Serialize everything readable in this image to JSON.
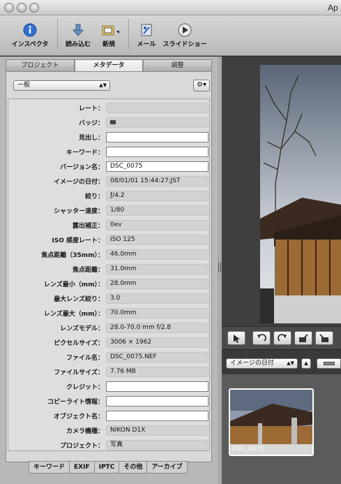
{
  "window": {
    "title": "Ap"
  },
  "toolbar": {
    "items": [
      {
        "label": "インスペクタ",
        "icon": "info-icon"
      },
      {
        "label": "読み込む",
        "icon": "import-arrow-icon"
      },
      {
        "label": "新規",
        "icon": "new-folder-icon"
      },
      {
        "label": "メール",
        "icon": "mail-icon"
      },
      {
        "label": "スライドショー",
        "icon": "play-icon"
      }
    ]
  },
  "inspector": {
    "tabs": [
      "プロジェクト",
      "メタデータ",
      "調整"
    ],
    "active_tab": "メタデータ",
    "preset": "一般",
    "fields": [
      {
        "label": "レート：",
        "value": "",
        "editable": false
      },
      {
        "label": "バッジ：",
        "value": "",
        "editable": false,
        "badge": true
      },
      {
        "label": "見出し：",
        "value": "",
        "editable": true
      },
      {
        "label": "キーワード：",
        "value": "",
        "editable": true
      },
      {
        "label": "バージョン名：",
        "value": "DSC_0075",
        "editable": true
      },
      {
        "label": "イメージの日付：",
        "value": "08/01/01 15:44:27;JST",
        "editable": false
      },
      {
        "label": "絞り：",
        "value": "ƒ/4.2",
        "editable": false
      },
      {
        "label": "シャッター速度：",
        "value": "1/80",
        "editable": false
      },
      {
        "label": "露出補正：",
        "value": "0ev",
        "editable": false
      },
      {
        "label": "ISO 感度レート：",
        "value": "ISO 125",
        "editable": false
      },
      {
        "label": "焦点距離（35mm）：",
        "value": "46.0mm",
        "editable": false
      },
      {
        "label": "焦点距離：",
        "value": "31.0mm",
        "editable": false
      },
      {
        "label": "レンズ最小（mm）：",
        "value": "28.0mm",
        "editable": false
      },
      {
        "label": "最大レンズ絞り：",
        "value": "3.0",
        "editable": false
      },
      {
        "label": "レンズ最大（mm）：",
        "value": "70.0mm",
        "editable": false
      },
      {
        "label": "レンズモデル：",
        "value": "28.0-70.0 mm f/2.8",
        "editable": false
      },
      {
        "label": "ピクセルサイズ：",
        "value": "3006 × 1962",
        "editable": false
      },
      {
        "label": "ファイル名：",
        "value": "DSC_0075.NEF",
        "editable": false
      },
      {
        "label": "ファイルサイズ：",
        "value": "7.76 MB",
        "editable": false
      },
      {
        "label": "クレジット：",
        "value": "",
        "editable": true
      },
      {
        "label": "コピーライト情報：",
        "value": "",
        "editable": true
      },
      {
        "label": "オブジェクト名：",
        "value": "",
        "editable": true
      },
      {
        "label": "カメラ機種：",
        "value": "NIKON D1X",
        "editable": false
      },
      {
        "label": "プロジェクト：",
        "value": "写真",
        "editable": false
      }
    ],
    "bottom_tabs": [
      "キーワード",
      "EXIF",
      "IPTC",
      "その他",
      "アーカイブ"
    ]
  },
  "browser": {
    "sort_label": "イメージの日付",
    "thumbnails": [
      {
        "caption": "DSC_0075"
      }
    ]
  },
  "colors": {
    "inspector_bg": "#b9b9b9",
    "viewer_bg": "#3f3f3f",
    "selection": "#ffffff"
  }
}
